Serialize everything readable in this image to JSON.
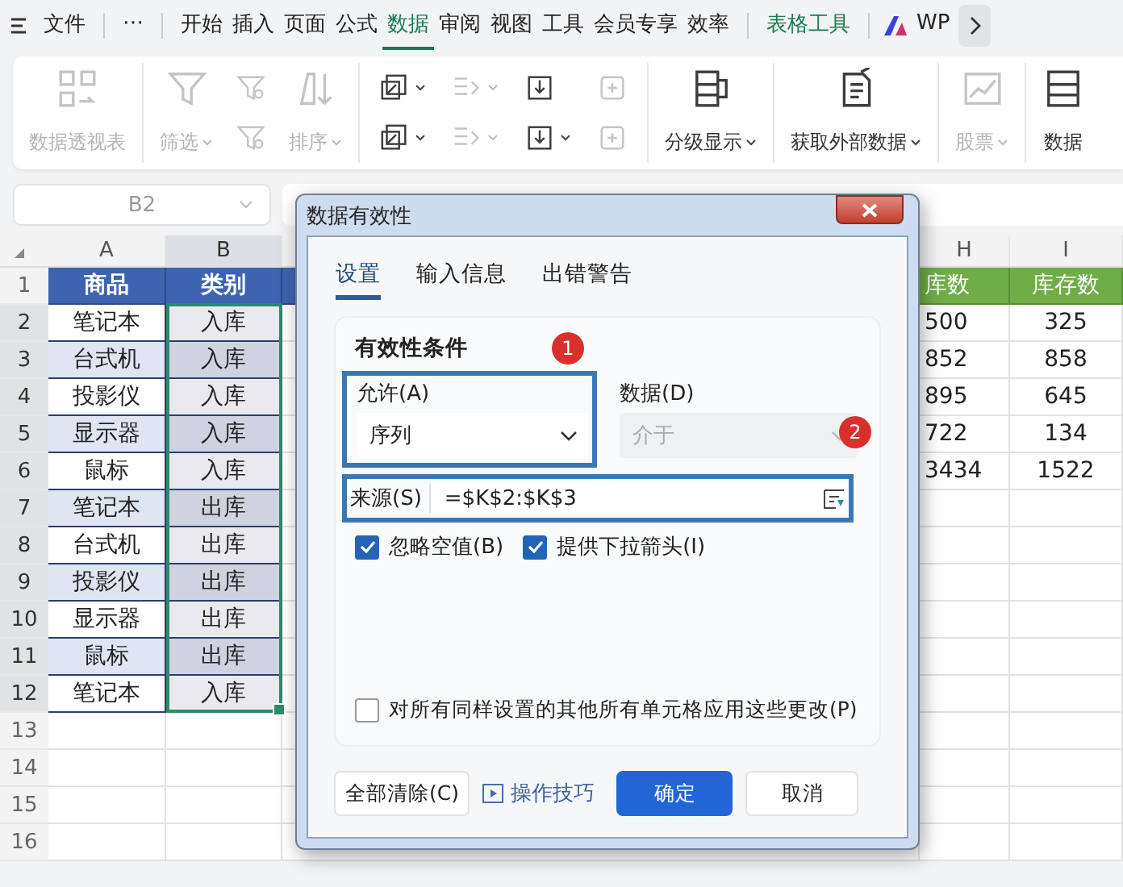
{
  "menu": {
    "groups": [
      [
        {
          "label": "文件",
          "kind": "file",
          "selected": false
        }
      ],
      [
        {
          "label": "⋯",
          "kind": "plain",
          "selected": false
        }
      ],
      [
        {
          "label": "开始",
          "kind": "plain",
          "selected": false
        },
        {
          "label": "插入",
          "kind": "plain",
          "selected": false
        },
        {
          "label": "页面",
          "kind": "plain",
          "selected": false
        },
        {
          "label": "公式",
          "kind": "plain",
          "selected": false
        },
        {
          "label": "数据",
          "kind": "plain",
          "selected": true
        },
        {
          "label": "审阅",
          "kind": "plain",
          "selected": false
        },
        {
          "label": "视图",
          "kind": "plain",
          "selected": false
        },
        {
          "label": "工具",
          "kind": "plain",
          "selected": false
        },
        {
          "label": "会员专享",
          "kind": "plain",
          "selected": false
        },
        {
          "label": "效率",
          "kind": "plain",
          "selected": false
        }
      ],
      [
        {
          "label": "表格工具",
          "kind": "contextual",
          "selected": false
        }
      ],
      [
        {
          "label": "WP",
          "kind": "ai",
          "selected": false
        }
      ]
    ]
  },
  "ribbon": {
    "groups": [
      {
        "items": [
          {
            "kind": "large",
            "label": "数据透视表",
            "caret": false,
            "disabled": true
          }
        ]
      },
      {
        "items": [
          {
            "kind": "large",
            "label": "筛选",
            "caret": true,
            "disabled": true
          },
          {
            "kind": "stack",
            "icons": [
              {
                "caret": false,
                "disabled": true
              },
              {
                "caret": false,
                "disabled": true
              }
            ]
          },
          {
            "kind": "large",
            "label": "排序",
            "caret": true,
            "disabled": true
          }
        ]
      },
      {
        "items": [
          {
            "kind": "stack",
            "icons": [
              {
                "caret": true,
                "disabled": false
              },
              {
                "caret": true,
                "disabled": false
              }
            ]
          },
          {
            "kind": "stack",
            "icons": [
              {
                "caret": true,
                "disabled": true
              },
              {
                "caret": true,
                "disabled": true
              }
            ]
          },
          {
            "kind": "stack",
            "icons": [
              {
                "caret": false,
                "disabled": false
              },
              {
                "caret": true,
                "disabled": false
              }
            ]
          },
          {
            "kind": "stack",
            "icons": [
              {
                "caret": false,
                "disabled": true
              },
              {
                "caret": false,
                "disabled": true
              }
            ]
          }
        ]
      },
      {
        "items": [
          {
            "kind": "large",
            "label": "分级显示",
            "caret": true,
            "disabled": false
          }
        ]
      },
      {
        "items": [
          {
            "kind": "large",
            "label": "获取外部数据",
            "caret": true,
            "disabled": false
          }
        ]
      },
      {
        "items": [
          {
            "kind": "large",
            "label": "股票",
            "caret": true,
            "disabled": true
          }
        ]
      },
      {
        "items": [
          {
            "kind": "large",
            "label": "数据",
            "caret": false,
            "disabled": false
          }
        ]
      }
    ]
  },
  "name_box": {
    "value": "B2"
  },
  "grid": {
    "columns": [
      {
        "label": "A",
        "selected": false
      },
      {
        "label": "B",
        "selected": true
      },
      {
        "label": "H",
        "selected": false
      },
      {
        "label": "I",
        "selected": false
      }
    ],
    "rows": [
      {
        "num": "1",
        "kind": "header",
        "selected": false,
        "a": "商品",
        "b": "类别",
        "h": "库数",
        "i": "库存数"
      },
      {
        "num": "2",
        "kind": "data",
        "selected": true,
        "a": "笔记本",
        "b": "入库",
        "h": "500",
        "i": "325"
      },
      {
        "num": "3",
        "kind": "data",
        "selected": true,
        "a": "台式机",
        "b": "入库",
        "h": "852",
        "i": "858"
      },
      {
        "num": "4",
        "kind": "data",
        "selected": true,
        "a": "投影仪",
        "b": "入库",
        "h": "895",
        "i": "645"
      },
      {
        "num": "5",
        "kind": "data",
        "selected": true,
        "a": "显示器",
        "b": "入库",
        "h": "722",
        "i": "134"
      },
      {
        "num": "6",
        "kind": "data",
        "selected": true,
        "a": "鼠标",
        "b": "入库",
        "h": "3434",
        "i": "1522"
      },
      {
        "num": "7",
        "kind": "data",
        "selected": true,
        "a": "笔记本",
        "b": "出库"
      },
      {
        "num": "8",
        "kind": "data",
        "selected": true,
        "a": "台式机",
        "b": "出库"
      },
      {
        "num": "9",
        "kind": "data",
        "selected": true,
        "a": "投影仪",
        "b": "出库"
      },
      {
        "num": "10",
        "kind": "data",
        "selected": true,
        "a": "显示器",
        "b": "出库"
      },
      {
        "num": "11",
        "kind": "data",
        "selected": true,
        "a": "鼠标",
        "b": "出库"
      },
      {
        "num": "12",
        "kind": "data",
        "selected": true,
        "a": "笔记本",
        "b": "入库"
      },
      {
        "num": "13",
        "kind": "empty",
        "selected": false
      },
      {
        "num": "14",
        "kind": "empty",
        "selected": false
      },
      {
        "num": "15",
        "kind": "empty",
        "selected": false
      },
      {
        "num": "16",
        "kind": "empty",
        "selected": false
      }
    ]
  },
  "dialog": {
    "title": "数据有效性",
    "tabs": [
      {
        "label": "设置",
        "selected": true
      },
      {
        "label": "输入信息",
        "selected": false
      },
      {
        "label": "出错警告",
        "selected": false
      }
    ],
    "section_title": "有效性条件",
    "allow": {
      "label": "允许(A)",
      "value": "序列",
      "highlighted": true
    },
    "data": {
      "label": "数据(D)",
      "value": "介于",
      "disabled": true
    },
    "source": {
      "label": "来源(S)",
      "value": "=$K$2:$K$3",
      "highlighted": true
    },
    "badges": [
      "1",
      "2"
    ],
    "options": [
      {
        "label": "忽略空值(B)",
        "checked": true
      },
      {
        "label": "提供下拉箭头(I)",
        "checked": true
      }
    ],
    "apply_all": {
      "label": "对所有同样设置的其他所有单元格应用这些更改(P)",
      "checked": false
    },
    "buttons": [
      {
        "label": "全部清除(C)",
        "kind": "default"
      },
      {
        "label": "操作技巧",
        "kind": "link"
      },
      {
        "label": "确定",
        "kind": "primary"
      },
      {
        "label": "取消",
        "kind": "default"
      }
    ]
  }
}
